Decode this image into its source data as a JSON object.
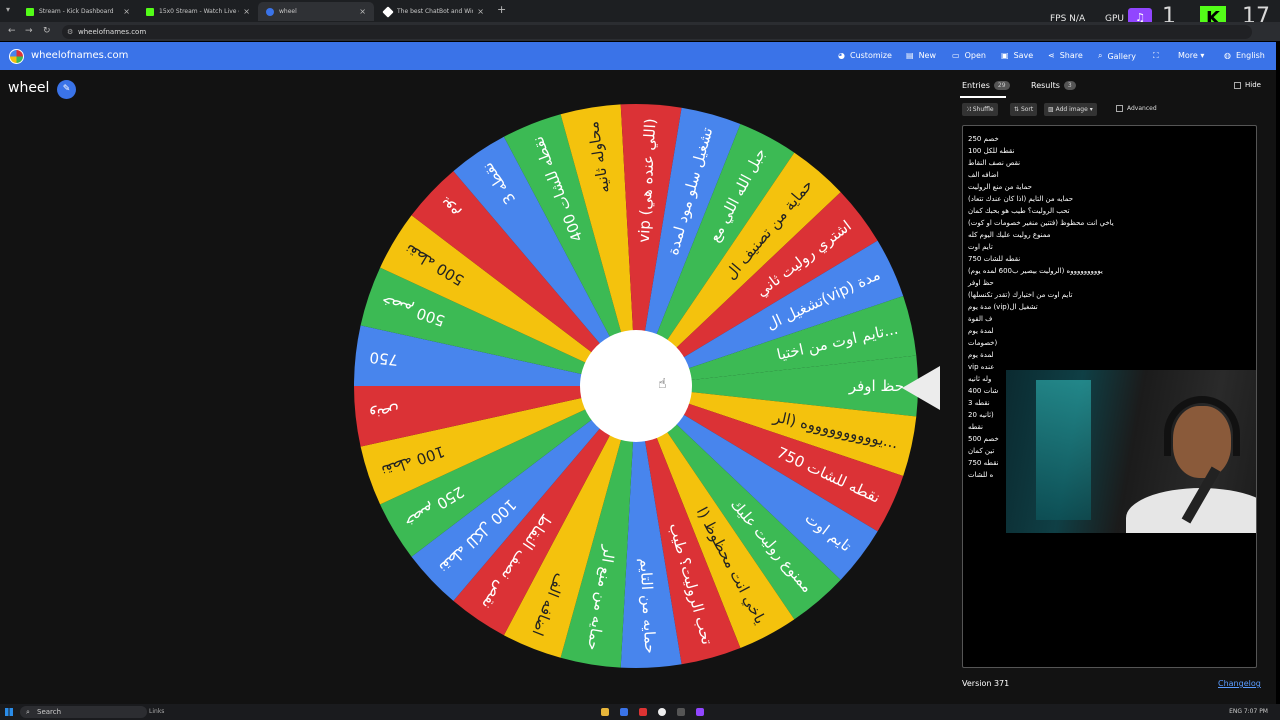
{
  "browser": {
    "tabs": [
      {
        "label": "Stream - Kick Dashboard",
        "color": "#53fc18"
      },
      {
        "label": "15x0 Stream - Watch Live on Ki",
        "color": "#53fc18"
      },
      {
        "label": "wheel",
        "color": "#3a73e8"
      },
      {
        "label": "The best ChatBot and Widgets",
        "color": "#ffffff"
      }
    ],
    "url": "wheelofnames.com",
    "overlay": {
      "fps": "FPS  N/A",
      "gpu": "GPU",
      "twitch_glyph": "♫",
      "kick_glyph": "K",
      "num1": "1",
      "num2": "17"
    }
  },
  "header": {
    "site_name": "wheelofnames.com",
    "buttons": [
      {
        "label": "Customize",
        "icon": "palette-icon"
      },
      {
        "label": "New",
        "icon": "new-file-icon"
      },
      {
        "label": "Open",
        "icon": "folder-icon"
      },
      {
        "label": "Save",
        "icon": "save-icon"
      },
      {
        "label": "Share",
        "icon": "share-icon"
      },
      {
        "label": "Gallery",
        "icon": "search-icon"
      },
      {
        "label": "",
        "icon": "fullscreen-icon"
      },
      {
        "label": "More ▾",
        "icon": ""
      },
      {
        "label": "English",
        "icon": "globe-icon"
      }
    ]
  },
  "wheel": {
    "title": "wheel",
    "segment_colors": [
      "#3cba54",
      "#f4c20d",
      "#db3236",
      "#4885ed"
    ],
    "segment_count": 29,
    "segments": [
      "حظ اوفر",
      "يووووووووووه (الر...",
      "نقطه للشات 750",
      "تايم اوت",
      "ممنوع روليت عليك",
      "ياخي انت محظوظ (ا",
      "تحب الروليت؟ طيب",
      "حمايه من التايم",
      "حمايه من منع الر",
      "اضافه الف",
      "نقص نصف النقاط",
      "100 نقطه للكل",
      "250 خصم",
      "100 نقطه",
      "ونص",
      "750",
      "خصم 500",
      "500 نقطه",
      "يوم",
      "3 نقطه",
      "400 نقطه للشات",
      "محاوله ثانيه",
      "vip (اللي عنده هي)",
      "تشغيل سلو مود لمدة",
      "جبل الله اللي مع",
      "حماية من تصنيف ال",
      "اشتري روليت ثاني",
      "تشغيل ال(vip) مدة",
      "تايم اوت من اختيا..."
    ]
  },
  "sidebar": {
    "entries_tab": "Entries",
    "entries_count": "29",
    "results_tab": "Results",
    "results_count": "3",
    "hide": "Hide",
    "shuffle": "Shuffle",
    "sort": "Sort",
    "add_image": "Add image ▾",
    "advanced": "Advanced",
    "entries": [
      "خصم 250",
      "100 نقطه للكل",
      "نقص نصف النقاط",
      "اضافه الف",
      "حماية من منع الروليت",
      "حمايه من التايم (اذا كان عندك تتعاد)",
      "تحب الروليت؟ طيب هو بحبك كمان",
      "ياخي انت محظوظ (فتتين منغير خصومات او كوت)",
      "ممنوع روليت عليك اليوم كله",
      "تايم اوت",
      "750 نقطه للشات",
      "يوووووووووه (الروليت بيصير ب600 لمده يوم)",
      "حظ اوفر",
      "تايم اوت من اختيارك (تقدر تكنسلها)",
      "مدة يوم (vip)تشغيل ال",
      "ف القوة",
      "لمدة يوم",
      "خصومات)",
      "لمدة يوم",
      "vip عنده",
      "وله ثانيه",
      "شات 400",
      "نقطه 3",
      "20 ثانيه)",
      "نقطه",
      "500 خصم",
      "تين كمان",
      "750 نقطه",
      "ه للشات"
    ],
    "version": "Version 371",
    "changelog": "Changelog"
  },
  "taskbar": {
    "search": "Search",
    "links": "Links",
    "tray": "ENG",
    "clock": "7:07 PM"
  }
}
